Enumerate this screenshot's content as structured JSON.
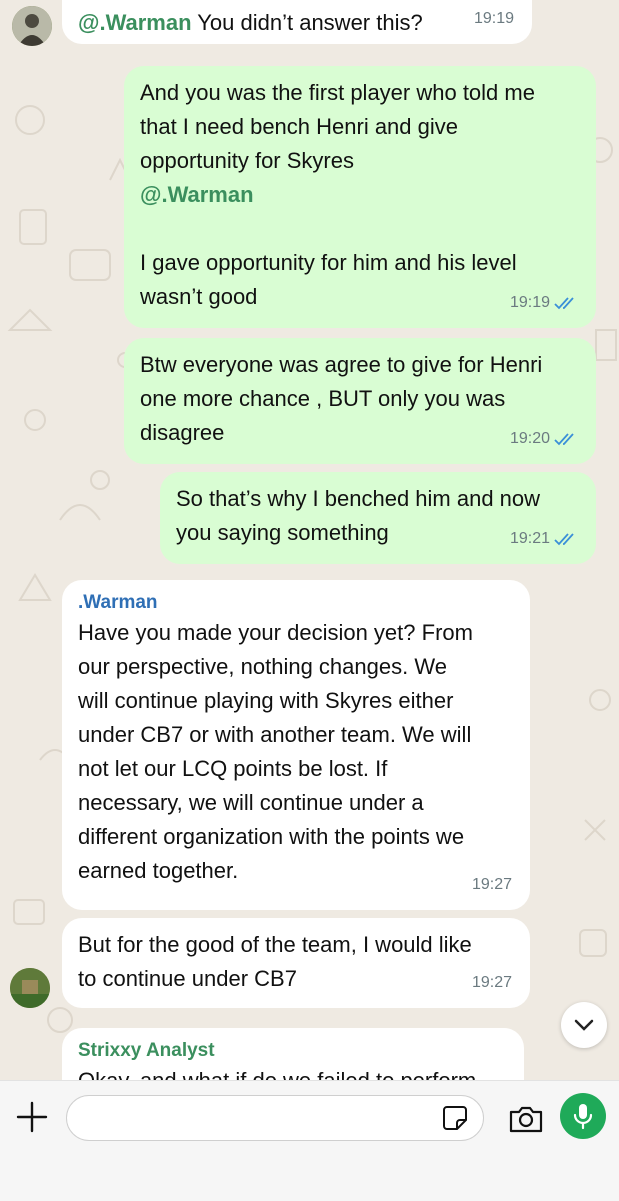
{
  "messages": [
    {
      "id": "m0",
      "direction": "in",
      "sender": "",
      "mention": "@.Warman",
      "text": "You didn’t answer this?",
      "time": "19:19"
    },
    {
      "id": "m1",
      "direction": "out",
      "text": "And you was the first player who told me\nthat I need bench Henri and give\nopportunity for Skyres",
      "mention": "@.Warman",
      "text2": "I gave opportunity for him and his level\nwasn’t good",
      "time": "19:19",
      "status": "read"
    },
    {
      "id": "m2",
      "direction": "out",
      "text": "Btw everyone was agree to give for Henri\none more chance , BUT only you was\ndisagree",
      "time": "19:20",
      "status": "read"
    },
    {
      "id": "m3",
      "direction": "out",
      "text": "So that’s why I benched him and now\nyou saying something",
      "time": "19:21",
      "status": "read"
    },
    {
      "id": "m4",
      "direction": "in",
      "sender": ".Warman",
      "text": "Have you made your decision yet? From\nour perspective, nothing changes. We\nwill continue playing with Skyres either\nunder CB7 or with another team. We will\nnot let our LCQ points be lost. If\nnecessary, we will continue under a\ndifferent organization with the points we\nearned together.",
      "time": "19:27"
    },
    {
      "id": "m5",
      "direction": "in",
      "text": "But for the good of the team, I would like\nto continue under CB7",
      "time": "19:27"
    },
    {
      "id": "m6",
      "direction": "in",
      "sender": "Strixxy Analyst",
      "text": "Okay, and what if do we failed to perform",
      "time": ""
    }
  ],
  "colors": {
    "outgoing_bubble": "#d9fdd3",
    "incoming_bubble": "#ffffff",
    "warman_name": "#2f6fb5",
    "strixxy_name": "#3b8f5e",
    "mention": "#3b8f5e",
    "read_ticks": "#3a8fd8",
    "mic_button": "#1faa59"
  },
  "composer": {
    "placeholder": "",
    "icons": [
      "plus-icon",
      "sticker-icon",
      "camera-icon",
      "microphone-icon"
    ]
  },
  "scroll_button_icon": "chevron-down-icon"
}
